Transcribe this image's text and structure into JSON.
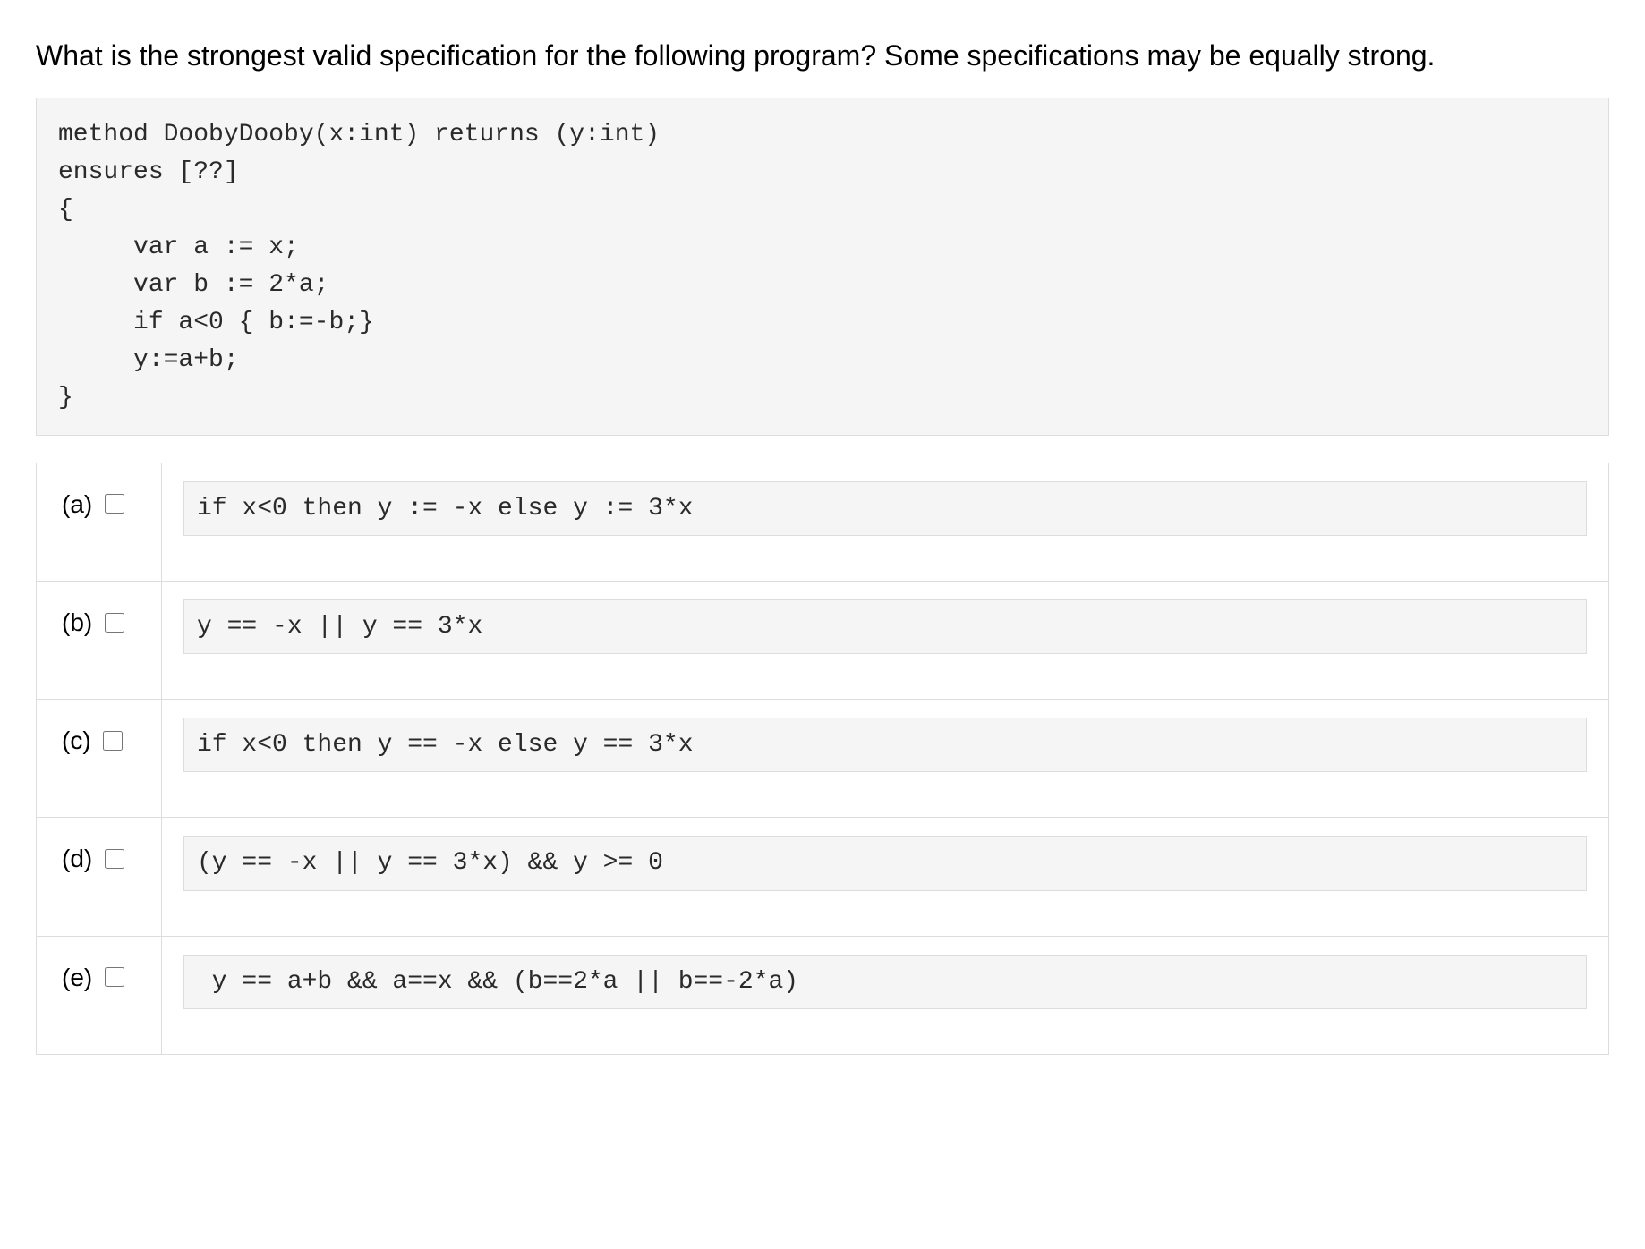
{
  "question": "What is the strongest valid specification for the following program? Some specifications may be equally strong.",
  "code": "method DoobyDooby(x:int) returns (y:int)\nensures [??]\n{\n     var a := x;\n     var b := 2*a;\n     if a<0 { b:=-b;}\n     y:=a+b;\n}",
  "options": [
    {
      "label": "(a)",
      "code": "if x<0 then y := -x else y := 3*x"
    },
    {
      "label": "(b)",
      "code": "y == -x || y == 3*x"
    },
    {
      "label": "(c)",
      "code": "if x<0 then y == -x else y == 3*x"
    },
    {
      "label": "(d)",
      "code": "(y == -x || y == 3*x) && y >= 0"
    },
    {
      "label": "(e)",
      "code": " y == a+b && a==x && (b==2*a || b==-2*a)"
    }
  ]
}
